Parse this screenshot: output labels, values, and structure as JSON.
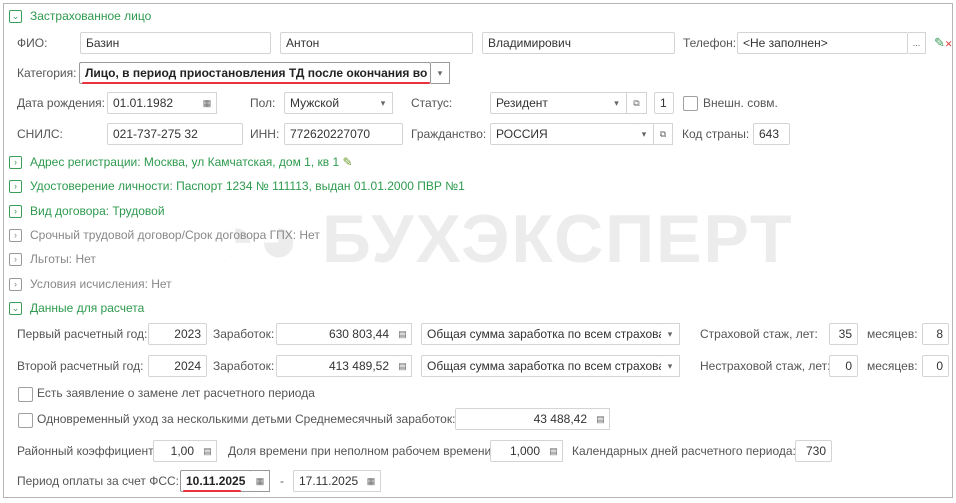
{
  "watermark": "БУХЭКСПЕРТ",
  "colors": {
    "section_green": "#2e9a4e",
    "highlight_red": "#e8323c"
  },
  "insured": {
    "title": "Застрахованное лицо",
    "fio_label": "ФИО:",
    "last_name": "Базин",
    "first_name": "Антон",
    "patronymic": "Владимирович",
    "phone_label": "Телефон:",
    "phone_value": "<Не заполнен>",
    "phone_more": "...",
    "category_label": "Категория:",
    "category_value": "Лицо, в период приостановления ТД после окончания во",
    "birth_label": "Дата рождения:",
    "birth_value": "01.01.1982",
    "sex_label": "Пол:",
    "sex_value": "Мужской",
    "status_label": "Статус:",
    "status_value": "Резидент",
    "status_num": "1",
    "external_label": "Внешн. совм.",
    "snils_label": "СНИЛС:",
    "snils_value": "021-737-275 32",
    "inn_label": "ИНН:",
    "inn_value": "772620227070",
    "citizenship_label": "Гражданство:",
    "citizenship_value": "РОССИЯ",
    "country_code_label": "Код страны:",
    "country_code_value": "643"
  },
  "sections": [
    "Адрес регистрации: Москва, ул Камчатская, дом 1, кв 1",
    "Удостоверение личности: Паспорт 1234 № 111113, выдан 01.01.2000 ПВР №1",
    "Вид договора: Трудовой",
    "Срочный трудовой договор/Срок договора ГПХ: Нет",
    "Льготы: Нет",
    "Условия исчисления: Нет"
  ],
  "calc": {
    "title": "Данные для расчета",
    "year1_label": "Первый расчетный год:",
    "year1": "2023",
    "earn_label": "Заработок:",
    "earn1": "630 803,44",
    "earn_type1": "Общая сумма заработка по всем страхова",
    "ins_label": "Страховой стаж, лет:",
    "ins_years": "35",
    "months_label": "месяцев:",
    "ins_months": "8",
    "year2_label": "Второй расчетный год:",
    "year2": "2024",
    "earn2": "413 489,52",
    "earn_type2": "Общая сумма заработка по всем страхова",
    "nonins_label": "Нестраховой стаж, лет:",
    "nonins_years": "0",
    "nonins_months": "0",
    "replace_label": "Есть заявление о замене лет расчетного периода",
    "multi_label": "Одновременный уход за несколькими детьми",
    "avg_label": "Среднемесячный заработок:",
    "avg_value": "43 488,42",
    "district_label": "Районный коэффициент:",
    "district_value": "1,00",
    "parttime_label": "Доля времени при неполном рабочем времени:",
    "parttime_value": "1,000",
    "days_label": "Календарных дней расчетного периода:",
    "days_value": "730",
    "period_label": "Период оплаты за счет ФСС:",
    "period_from": "10.11.2025",
    "period_dash": "-",
    "period_to": "17.11.2025"
  }
}
